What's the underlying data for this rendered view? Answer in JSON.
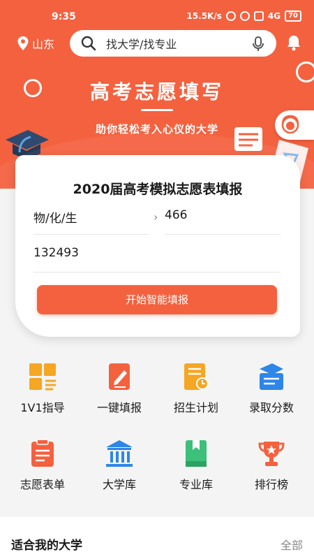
{
  "status": {
    "time": "9:35",
    "speed": "15.5K/s",
    "signal": "4G",
    "battery": "70"
  },
  "header": {
    "location": "山东",
    "search_placeholder": "找大学/找专业",
    "title": "高考志愿填写",
    "subtitle": "助你轻松考入心仪的大学"
  },
  "card": {
    "title": "2020届高考模拟志愿表填报",
    "subject": "物/化/生",
    "score": "466",
    "rank": "132493",
    "button": "开始智能填报"
  },
  "grid": [
    {
      "label": "1V1指导",
      "icon": "guidance-icon"
    },
    {
      "label": "一键填报",
      "icon": "one-click-fill-icon"
    },
    {
      "label": "招生计划",
      "icon": "enrollment-plan-icon"
    },
    {
      "label": "录取分数",
      "icon": "admission-score-icon"
    },
    {
      "label": "志愿表单",
      "icon": "application-form-icon"
    },
    {
      "label": "大学库",
      "icon": "university-icon"
    },
    {
      "label": "专业库",
      "icon": "major-library-icon"
    },
    {
      "label": "排行榜",
      "icon": "trophy-icon"
    }
  ],
  "section": {
    "title": "适合我的大学",
    "more": "全部"
  },
  "colors": {
    "brand": "#f4613f",
    "orange": "#f5a623",
    "blue": "#2d86e8",
    "green": "#3cc07a"
  }
}
